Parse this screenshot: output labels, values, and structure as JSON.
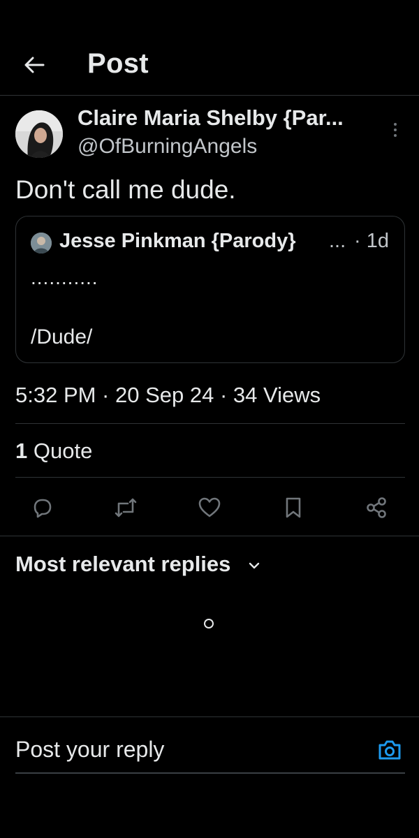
{
  "header": {
    "title": "Post",
    "back_icon": "arrow-left-icon"
  },
  "post": {
    "author_name": "Claire Maria Shelby {Par...",
    "author_handle": "@OfBurningAngels",
    "text": "Don't call me dude.",
    "quoted": {
      "author_name": "Jesse Pinkman {Parody}",
      "ellipsis": "...",
      "time": "· 1d",
      "line1": "...........",
      "line2": "/Dude/"
    },
    "timestamp": "5:32 PM · 20 Sep 24 · 34 Views",
    "quote_count": "1",
    "quote_label": "Quote"
  },
  "actions": [
    "reply-icon",
    "retweet-icon",
    "like-icon",
    "bookmark-icon",
    "share-icon"
  ],
  "replies": {
    "header": "Most relevant replies"
  },
  "composer": {
    "placeholder": "Post your reply"
  },
  "colors": {
    "background": "#000000",
    "text": "#e7e9ea",
    "muted": "#c2c6ca",
    "divider": "#2f3336",
    "accent": "#1d9bf0"
  }
}
